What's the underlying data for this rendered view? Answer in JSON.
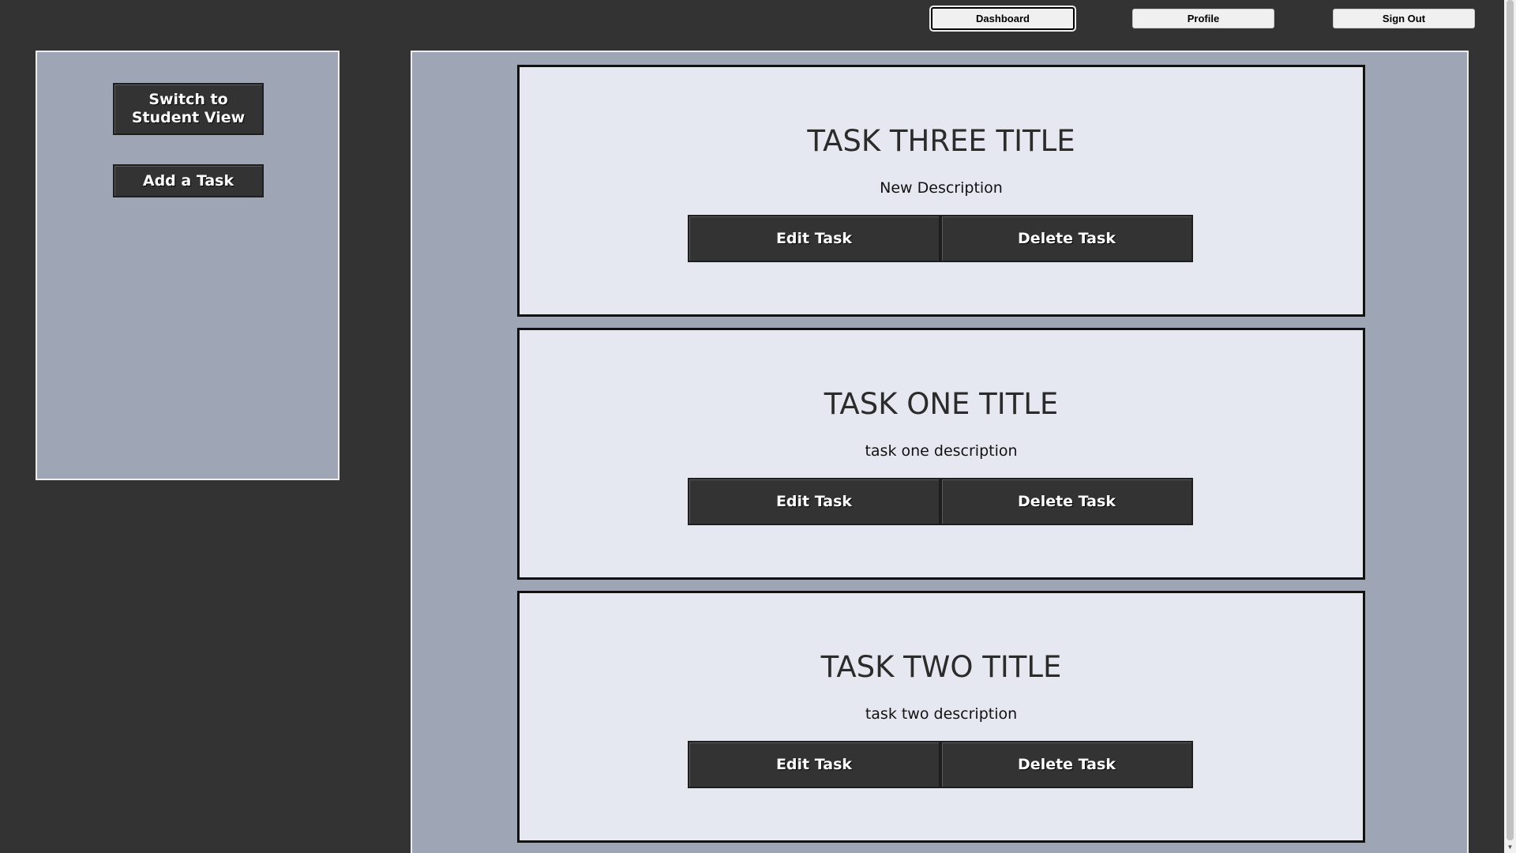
{
  "nav": {
    "dashboard_label": "Dashboard",
    "profile_label": "Profile",
    "signout_label": "Sign Out"
  },
  "sidebar": {
    "switch_label": "Switch to Student View",
    "add_label": "Add a Task"
  },
  "tasks": [
    {
      "title": "TASK THREE TITLE",
      "description": "New Description",
      "edit_label": "Edit Task",
      "delete_label": "Delete Task"
    },
    {
      "title": "TASK ONE TITLE",
      "description": "task one description",
      "edit_label": "Edit Task",
      "delete_label": "Delete Task"
    },
    {
      "title": "TASK TWO TITLE",
      "description": "task two description",
      "edit_label": "Edit Task",
      "delete_label": "Delete Task"
    }
  ],
  "colors": {
    "page_background": "#333333",
    "panel_background": "#9ea5b5",
    "card_background": "#e5e8f0",
    "button_background": "#333333"
  }
}
